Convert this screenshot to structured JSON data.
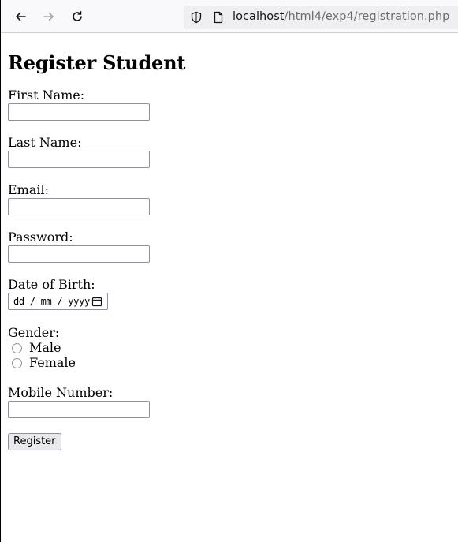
{
  "browser": {
    "url_host": "localhost",
    "url_path": "/html4/exp4/registration.php"
  },
  "page": {
    "title": "Register Student"
  },
  "form": {
    "first_name_label": "First Name:",
    "last_name_label": "Last Name:",
    "email_label": "Email:",
    "password_label": "Password:",
    "dob_label": "Date of Birth:",
    "dob_placeholder": "dd / mm / yyyy",
    "gender_label": "Gender:",
    "gender_options": [
      "Male",
      "Female"
    ],
    "mobile_label": "Mobile Number:",
    "submit_label": "Register"
  },
  "icons": {
    "back": "back-arrow-icon",
    "forward": "forward-arrow-icon",
    "reload": "reload-icon",
    "shield": "shield-icon",
    "page": "page-icon",
    "calendar": "calendar-icon"
  },
  "colors": {
    "toolbar_bg": "#f9f9fb",
    "urlbar_bg": "#efeff2",
    "input_border": "#8f8f9d",
    "button_bg": "#e9e9ed"
  }
}
